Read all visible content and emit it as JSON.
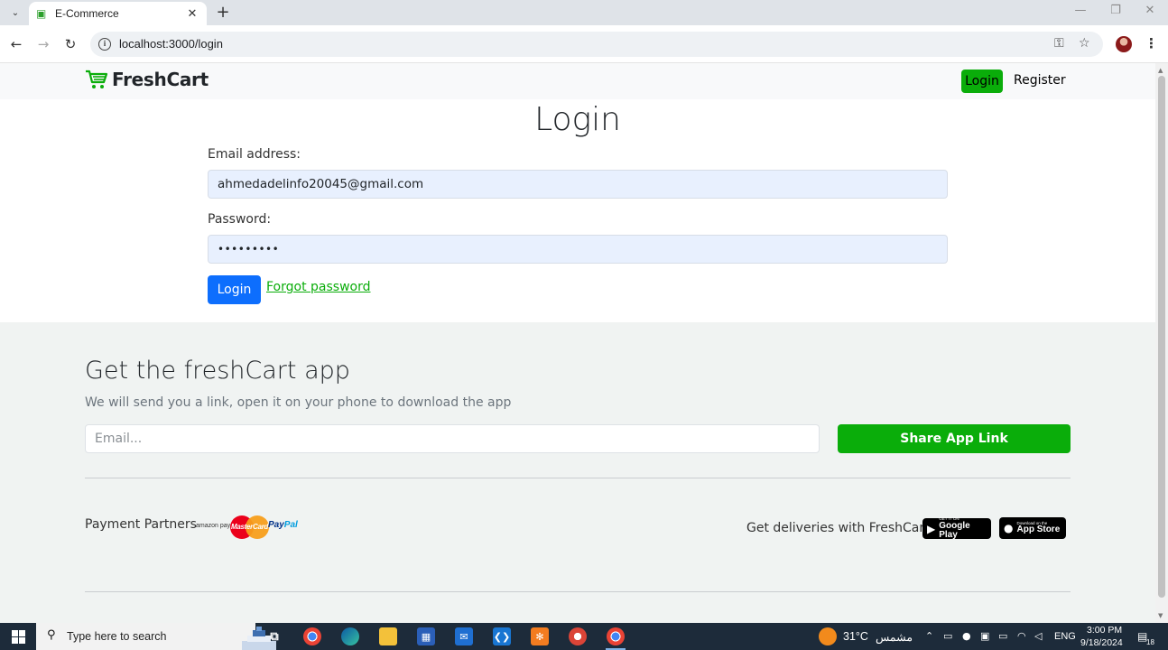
{
  "browser": {
    "tab_title": "E-Commerce",
    "url": "localhost:3000/login",
    "new_tab": "+",
    "tab_close": "✕",
    "tab_list": "⌄"
  },
  "navbar": {
    "brand": "FreshCart",
    "login_label": "Login",
    "register_label": "Register"
  },
  "login_form": {
    "title": "Login",
    "email_label": "Email address:",
    "email_value": "ahmedadelinfo20045@gmail.com",
    "password_label": "Password:",
    "password_value": "•••••••••",
    "submit_label": "Login",
    "forgot_label": "Forgot password"
  },
  "footer": {
    "app_title": "Get the freshCart app",
    "app_subtitle": "We will send you a link, open it on your phone to download the app",
    "email_placeholder": "Email...",
    "share_label": "Share App Link",
    "payment_label": "Payment Partners",
    "payment_partners": {
      "amazon": "amazon pay",
      "mastercard": "MasterCard",
      "paypal_a": "Pay",
      "paypal_b": "Pal"
    },
    "delivery_label": "Get deliveries with FreshCart",
    "google_play": {
      "small": "GET IT ON",
      "big": "Google Play"
    },
    "app_store": {
      "small": "Download on the",
      "big": "App Store"
    }
  },
  "taskbar": {
    "search_placeholder": "Type here to search",
    "weather_temp": "31°C",
    "weather_desc": "مشمس",
    "language": "ENG",
    "time": "3:00 PM",
    "date": "9/18/2024",
    "notification_count": "18"
  },
  "colors": {
    "brand_green": "#0aad0a",
    "primary_blue": "#0d6efd",
    "autofill_bg": "#e8f0fe",
    "footer_bg": "#f0f3f2"
  },
  "icons": {
    "logo": "cart-icon",
    "password_manager": "key-icon",
    "bookmark": "star-icon"
  }
}
